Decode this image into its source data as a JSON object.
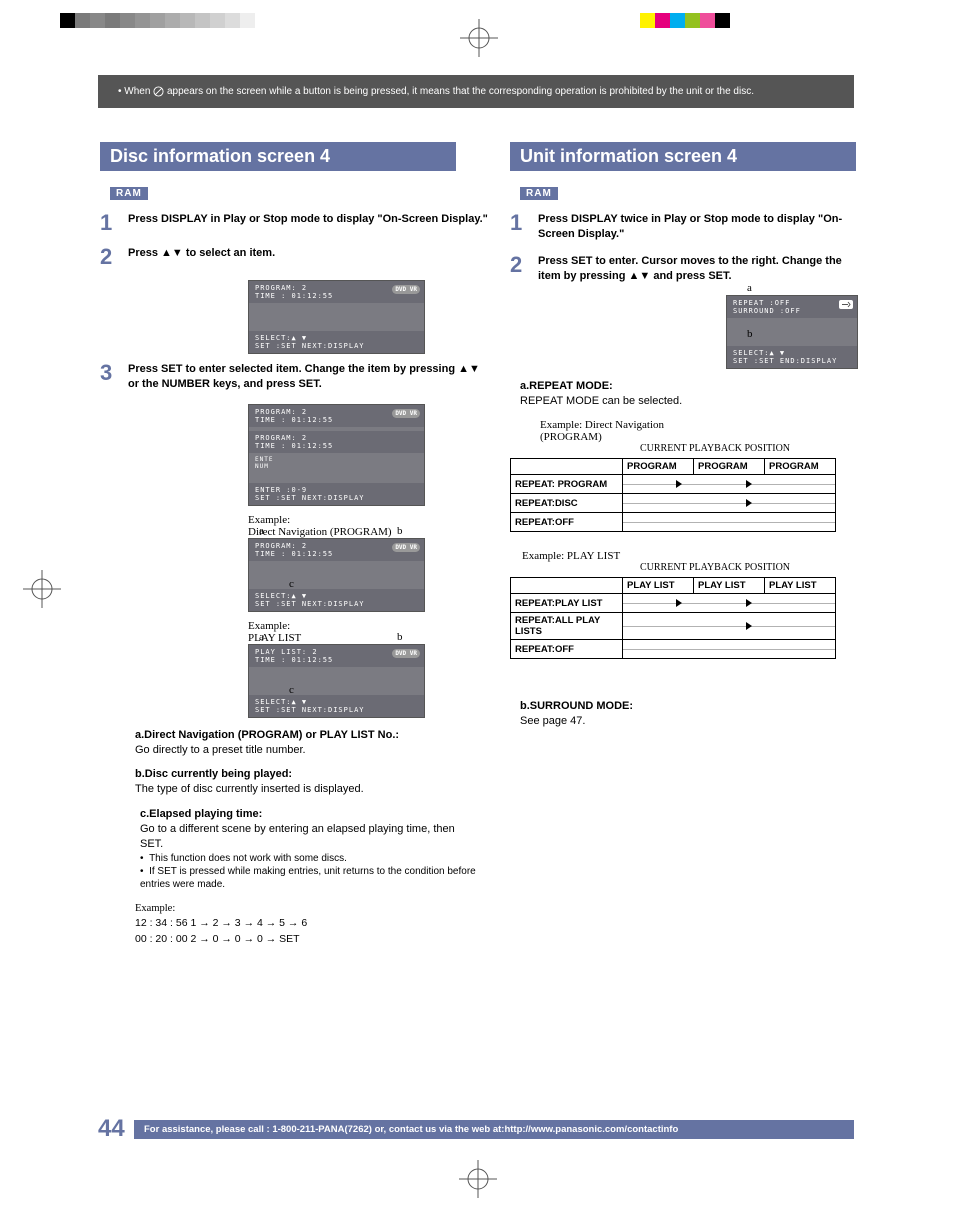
{
  "notice": {
    "prefix": "When",
    "suffix": "appears on the screen while a button is being pressed, it means that the corresponding operation is prohibited by the unit or the disc."
  },
  "left": {
    "title": "Disc information screen 4",
    "ram": "RAM",
    "step1": "Press DISPLAY in Play or Stop mode to display \"On-Screen Display.\"",
    "step2a": "Press ",
    "step2b": " to select an item.",
    "step3a": "Press SET to enter selected item. Change the item by pressing ",
    "step3b": " or the NUMBER keys, and press SET.",
    "osd1": {
      "line1": "PROGRAM:  2",
      "line2": "TIME   : 01:12:55",
      "foot1": "SELECT:▲ ▼",
      "foot2": "SET   :SET          NEXT:DISPLAY",
      "dv": "DVD VR"
    },
    "osd2a": {
      "line1": "PROGRAM:  2",
      "line2": "TIME   : 01:12:55"
    },
    "osd2b": {
      "line1": "PROGRAM:  2",
      "line2": "TIME   : 01:12:55"
    },
    "osd2c": {
      "line1": "ENTER :0-9",
      "line2": "SET   :SET          NEXT:DISPLAY"
    },
    "ex1_lbl": "Example:\nDirect Navigation (PROGRAM)",
    "ex2_lbl": "Example:\nPLAY LIST",
    "osd_ex2": {
      "line1": "PLAY LIST:  2",
      "line2": "TIME   : 01:12:55"
    },
    "noteA_h": "a.Direct Navigation (PROGRAM) or PLAY LIST No.:",
    "noteA_b": "Go directly to a preset title number.",
    "noteB_h": "b.Disc currently being played:",
    "noteB_b": "The type of disc currently inserted is displayed.",
    "noteC_h": "c.Elapsed playing time:",
    "noteC_b": "Go to a different scene by entering an elapsed playing time, then SET.",
    "bul1": "This function does not work with some discs.",
    "bul2": "If SET is pressed while making entries, unit returns to the condition before entries were made.",
    "ex_h": "Example:",
    "ex_l1": "12 : 34 : 56    1 → 2 → 3 → 4 → 5 → 6",
    "ex_l2": "00 : 20 : 00    2 → 0 → 0 → 0 → SET"
  },
  "right": {
    "title": "Unit information screen 4",
    "ram": "RAM",
    "step1": "Press DISPLAY twice in Play or Stop mode  to display \"On-Screen Display.\"",
    "step2a": "Press SET to enter. Cursor moves to the right. Change the item by pressing ",
    "step2b": " and press SET.",
    "osd1": {
      "line1": "REPEAT        :OFF",
      "line2": "SURROUND      :OFF",
      "foot1": "SELECT:▲ ▼",
      "foot2": "SET   :SET          END:DISPLAY"
    },
    "ra_h": "a.REPEAT MODE:",
    "ra_b": "REPEAT MODE can be selected.",
    "exA_l": "Example:  Direct Navigation\n              (PROGRAM)",
    "cur_pos": "CURRENT PLAYBACK POSITION",
    "tbl1": {
      "h": [
        "PROGRAM",
        "PROGRAM",
        "PROGRAM"
      ],
      "r": [
        "REPEAT: PROGRAM",
        "REPEAT:DISC",
        "REPEAT:OFF"
      ]
    },
    "exB_l": "Example:  PLAY LIST",
    "tbl2": {
      "h": [
        "PLAY LIST",
        "PLAY LIST",
        "PLAY LIST"
      ],
      "r": [
        "REPEAT:PLAY LIST",
        "REPEAT:ALL PLAY LISTS",
        "REPEAT:OFF"
      ]
    },
    "sb_h": "b.SURROUND MODE:",
    "sb_b": "See page 47."
  },
  "footer": {
    "page": "44",
    "text": "For assistance, please call : 1-800-211-PANA(7262) or, contact us via the web at:http://www.panasonic.com/contactinfo"
  },
  "swatches": [
    "#000",
    "#888",
    "#777",
    "#888",
    "#777",
    "#888",
    "#777",
    "#888",
    "#777",
    "#888",
    "#777",
    "#888",
    "#eee"
  ],
  "swatches_r": [
    "#fff200",
    "#e5007d",
    "#00aeef",
    "#94c11f",
    "#ef4e9b",
    "#000"
  ]
}
